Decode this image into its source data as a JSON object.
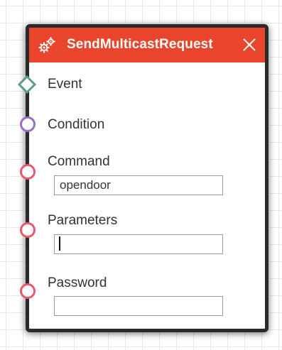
{
  "node": {
    "title": "SendMulticastRequest",
    "header_icon": "gears-icon",
    "close_icon": "close-icon",
    "accent_color": "#e8452c"
  },
  "ports": {
    "event": {
      "label": "Event",
      "shape": "diamond",
      "color": "#5a9e8a"
    },
    "condition": {
      "label": "Condition",
      "shape": "circle",
      "color": "#9b6fc2"
    },
    "command": {
      "label": "Command",
      "shape": "circle",
      "color": "#e85a6a"
    },
    "parameters": {
      "label": "Parameters",
      "shape": "circle",
      "color": "#e85a6a"
    },
    "password": {
      "label": "Password",
      "shape": "circle",
      "color": "#e85a6a"
    }
  },
  "fields": {
    "command_value": "opendoor",
    "parameters_value": "",
    "password_value": ""
  }
}
